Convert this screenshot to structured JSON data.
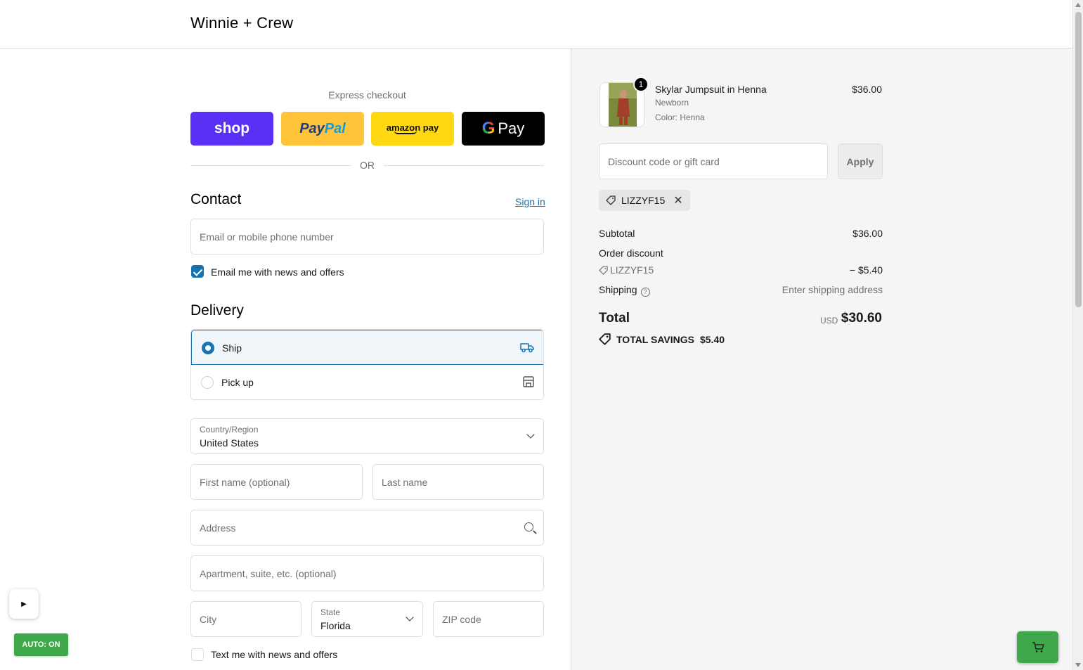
{
  "header": {
    "brand": "Winnie + Crew"
  },
  "express": {
    "title": "Express checkout",
    "shop_label": "shop",
    "paypal_label_a": "Pay",
    "paypal_label_b": "Pal",
    "amazon_label": "amazon pay",
    "gpay_label": "Pay",
    "or_label": "OR"
  },
  "contact": {
    "title": "Contact",
    "signin": "Sign in",
    "email_placeholder": "Email or mobile phone number",
    "news_label": "Email me with news and offers",
    "news_checked": true
  },
  "delivery": {
    "title": "Delivery",
    "options": [
      {
        "label": "Ship",
        "selected": true,
        "icon": "truck-icon"
      },
      {
        "label": "Pick up",
        "selected": false,
        "icon": "store-icon"
      }
    ],
    "country_label": "Country/Region",
    "country_value": "United States",
    "first_name_placeholder": "First name (optional)",
    "last_name_placeholder": "Last name",
    "address_placeholder": "Address",
    "apartment_placeholder": "Apartment, suite, etc. (optional)",
    "city_placeholder": "City",
    "state_label": "State",
    "state_value": "Florida",
    "zip_placeholder": "ZIP code",
    "text_label": "Text me with news and offers",
    "text_checked": false
  },
  "summary": {
    "item": {
      "name": "Skylar Jumpsuit in Henna",
      "size": "Newborn",
      "color": "Color: Henna",
      "price": "$36.00",
      "quantity": "1"
    },
    "discount_placeholder": "Discount code or gift card",
    "apply_label": "Apply",
    "applied_code": "LIZZYF15",
    "subtotal_label": "Subtotal",
    "subtotal_value": "$36.00",
    "order_discount_label": "Order discount",
    "discount_code": "LIZZYF15",
    "discount_value": "− $5.40",
    "shipping_label": "Shipping",
    "shipping_value": "Enter shipping address",
    "total_label": "Total",
    "currency": "USD",
    "total_value": "$30.60",
    "savings_label": "TOTAL SAVINGS",
    "savings_value": "$5.40"
  },
  "overlay": {
    "play_label": "▶",
    "auto_label": "AUTO: ON"
  },
  "colors": {
    "accent": "#1773b0",
    "shop_pay": "#5a31f4",
    "paypal": "#ffc439",
    "amazon_pay": "#ffd814",
    "overlay_green": "#3ea84a"
  }
}
